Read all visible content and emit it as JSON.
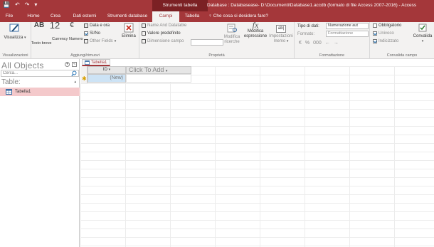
{
  "titlebar": {
    "qat": [
      "💾",
      "↶",
      "↷",
      "▾"
    ],
    "context_tools": "Strumenti tabella",
    "doc_title": "Database : Databasease- D:\\Documenti\\Database1.accdb (formato di file Access 2007-2016) - Access"
  },
  "tabs": [
    {
      "label": "File"
    },
    {
      "label": "Home"
    },
    {
      "label": "Crea"
    },
    {
      "label": "Dati esterni"
    },
    {
      "label": "Strumenti database"
    },
    {
      "label": "Campi"
    },
    {
      "label": "Tabella"
    }
  ],
  "tell_me": "Che cosa si desidera fare?",
  "ribbon": {
    "views": {
      "button": "Visualizza",
      "group": "Visualizzazioni"
    },
    "add_delete": {
      "text": "Testo breve",
      "number": "Numero",
      "currency": "Currency",
      "date": "Data e ora",
      "yesno": "Sì/No",
      "other": "Other Fields",
      "delete": "Elimina",
      "group": "Aggiungi/rimuovi"
    },
    "properties": {
      "name": "Name And Datatable",
      "default": "Valore predefinito",
      "size": "Dimensione campo",
      "modify_lookups": "Modifica ricerche",
      "modify_expr": "Modifica espressione",
      "memo": "Impostazioni memo",
      "group": "Proprietà"
    },
    "formatting": {
      "datatype_label": "Tipo di dati:",
      "datatype_value": "Numerazione aut",
      "format_label": "Formato:",
      "format_value": "Formattazione",
      "group": "Formattazione"
    },
    "validation": {
      "required": "Obbligatorio",
      "unique": "Univoco",
      "indexed": "Indicizzato",
      "validate": "Convalida",
      "group": "Convalida campo"
    }
  },
  "nav": {
    "header": "All Objects",
    "search_placeholder": "Cerca...",
    "group": "Table:",
    "items": [
      {
        "label": "Tabella1"
      }
    ]
  },
  "document": {
    "tab_label": "Tabella1",
    "columns": [
      "ID",
      "Click To Add"
    ],
    "new_row": "(New)"
  },
  "colors": {
    "accent": "#a4373a",
    "accent_dark": "#7b2124",
    "selection": "#f4c9cb",
    "new_row": "#cde3f5"
  }
}
